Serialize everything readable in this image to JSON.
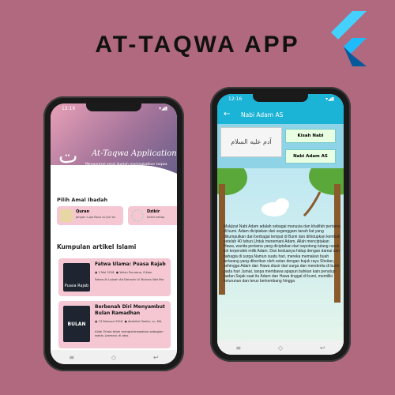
{
  "header": {
    "title": "AT-TAQWA APP"
  },
  "flutter_logo": {
    "icon": "flutter-logo-icon",
    "colors": [
      "#44d1fd",
      "#1fbcfd",
      "#08589c"
    ]
  },
  "phone1": {
    "status_time": "12:16",
    "app": {
      "logo": "ت",
      "title": "At-Taqwa Application",
      "subtitle": "Mengontrol amal ibadah meningkatkan taqwa"
    },
    "amal_section_title": "Pilih Amal Ibadah",
    "amal_items": [
      {
        "label": "Quran",
        "sub": "Jangan Lupa Baca Al-Qur'an",
        "icon": "quran-icon"
      },
      {
        "label": "Dzikir",
        "sub": "Dzikir setiap",
        "icon": "prayer-beads-icon"
      }
    ],
    "articles_title": "Kumpulan artikel Islami",
    "articles": [
      {
        "title": "Fatwa Ulama: Puasa Rajab",
        "date": "2 Mei 2018",
        "author": "Yulian Purnama, S.Kom",
        "desc": "Fatwa Al Lajnah Ad Daimah Lil Buhuts Wal Ifta",
        "thumb": "Puasa Rajab"
      },
      {
        "title": "Berbenah Diri Menyambut Bulan Ramadhan",
        "date": "13 Februari 2018",
        "author": "Abdullah Taslim, Lc, MA.",
        "desc": "Allah Ta'ala telah mengistimewakan sebagian waktu (zaman) di atas",
        "thumb": "BULAN"
      }
    ],
    "nav": [
      "≡",
      "◇",
      "↩"
    ]
  },
  "phone2": {
    "status_time": "12:16",
    "appbar_title": "Nabi Adam AS",
    "back_icon": "back-arrow-icon",
    "calligraphy": "آدم عليه السلام",
    "buttons": [
      "Kisah Nabi",
      "Nabi Adam AS"
    ],
    "story": "Mukjizat Nabi Adam adalah sebagai manusia dan khalifah pertama di bumi. Adam diciptakan dari segenggam tanah liat yang dikumpulkan dari berbagai tempat di Bumi dan dihidupkan kembali setelah 40 tahun.Untuk menemani Adam, Allah menciptakan Hawa, wanita pertama yang diciptakan dari sepotong tulang rusuk kiri terpendek milik Adam. Dan keduanya hidup dengan damai dan bahagia di surga.Namun suatu hari, mereka memakan buah terlarang yang diberikan oleh setan dengan bujuk rayu Sheitan, sehingga Adam dan Hawa diusir dari surga dan menderita di bumi pada hari Jumat, tanpa membawa apapun bahkan kain penutup badan.Sejak saat itu Adam dan Hawa tinggal di bumi, memiliki keturunan dan terus berkembang hingga",
    "nav": [
      "≡",
      "◇",
      "↩"
    ]
  }
}
